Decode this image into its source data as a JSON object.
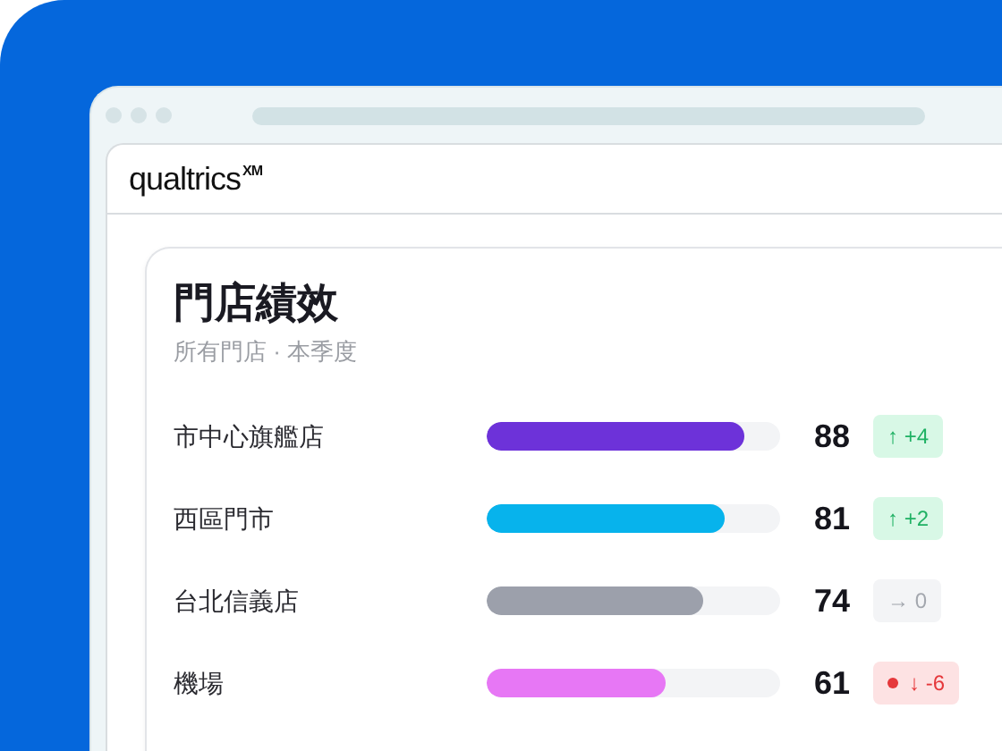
{
  "header": {
    "logo": "qualtrics",
    "logo_mark": "XM"
  },
  "card": {
    "title": "門店績效",
    "subtitle": "所有門店 · 本季度",
    "stores": [
      {
        "name": "市中心旗艦店",
        "level": 0.88,
        "color": "#6d32d9",
        "score": "88",
        "trend": {
          "kind": "up",
          "text": "↑ +4",
          "alert": false
        }
      },
      {
        "name": "西區門市",
        "level": 0.81,
        "color": "#07b3ec",
        "score": "81",
        "trend": {
          "kind": "up",
          "text": "↑ +2",
          "alert": false
        }
      },
      {
        "name": "台北信義店",
        "level": 0.74,
        "color": "#9ca0ab",
        "score": "74",
        "trend": {
          "kind": "flat",
          "text": "→ 0",
          "alert": false
        }
      },
      {
        "name": "機場",
        "level": 0.61,
        "color": "#e777f5",
        "score": "61",
        "trend": {
          "kind": "down",
          "text": "↓ -6",
          "alert": true
        }
      }
    ]
  }
}
